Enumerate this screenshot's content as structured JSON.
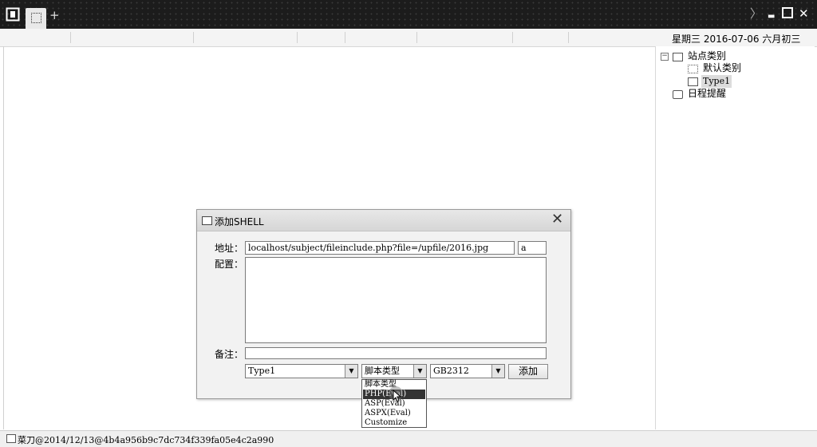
{
  "topbar": {
    "icons": [
      "panel-toggle-icon",
      "tab-icon",
      "add-tab-icon",
      "chevron-right-icon",
      "minimize-icon",
      "maximize-icon",
      "close-icon"
    ],
    "new_tab_symbol": "+",
    "chevron_symbol": "〉",
    "minimize_symbol": "▬",
    "maximize_symbol": "■",
    "close_symbol": "✕"
  },
  "header": {
    "date": "星期三 2016-07-06 六月初三"
  },
  "sidebar": {
    "tree": [
      {
        "label": "站点类别",
        "expander": "⊟"
      },
      {
        "label": "默认类别"
      },
      {
        "label": "Type1"
      },
      {
        "label": "日程提醒"
      }
    ]
  },
  "dialog": {
    "title": "添加SHELL",
    "close_symbol": "✕",
    "address_label": "地址：",
    "address_value": "localhost/subject/fileinclude.php?file=/upfile/2016.jpg",
    "password_value": "a",
    "config_label": "配置：",
    "config_value": "",
    "note_label": "备注：",
    "note_value": "",
    "category_value": "Type1",
    "script_type_value": "脚本类型",
    "encoding_value": "GB2312",
    "add_button": "添加",
    "arrow_symbol": "▼"
  },
  "dropdown": {
    "options": [
      "脚本类型",
      "PHP(Eval)",
      "ASP(Eval)",
      "ASPX(Eval)",
      "Customize"
    ],
    "selected_index": 1
  },
  "statusbar": {
    "text": "菜刀@2014/12/13@4b4a956b9c7dc734f339fa05e4c2a990"
  },
  "colors": {
    "titlebar_bg": "#1c1c1c",
    "dialog_bg": "#f2f2f2",
    "selected_bg": "#333333"
  }
}
